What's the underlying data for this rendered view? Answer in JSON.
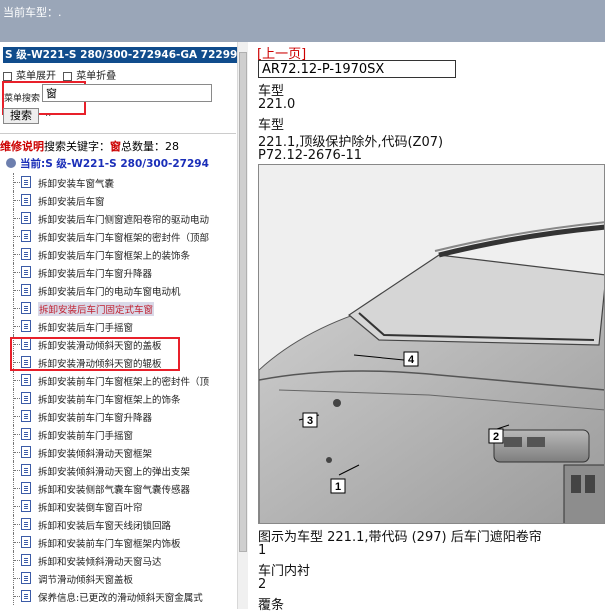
{
  "top": {
    "label": "当前车型：."
  },
  "left": {
    "header": "S 级-W221-S 280/300-272946-GA 72299",
    "menu_expand": "菜单展开",
    "menu_collapse": "菜单折叠",
    "search_label": "菜单搜索",
    "search_value": "窗",
    "search_button": "搜索",
    "search_extra": "..",
    "info_title": "维修说明",
    "info_keyword": "搜索关键字：",
    "info_keyword_value": "窗",
    "info_count_label": "总数量：",
    "info_count_value": "28",
    "root": "当前:S 级-W221-S 280/300-27294",
    "items": [
      "拆卸安装车窗气囊",
      "拆卸安装后车窗",
      "拆卸安装后车门侧窗遮阳卷帘的驱动电动",
      "拆卸安装后车门车窗框架的密封件（顶部",
      "拆卸安装后车门车窗框架上的装饰条",
      "拆卸安装后车门车窗升降器",
      "拆卸安装后车门的电动车窗电动机",
      "拆卸安装后车门固定式车窗",
      "拆卸安装后车门手摇窗",
      "拆卸安装滑动倾斜天窗的盖板",
      "拆卸安装滑动倾斜天窗的辊板",
      "拆卸安装前车门车窗框架上的密封件（顶",
      "拆卸安装前车门车窗框架上的饰条",
      "拆卸安装前车门车窗升降器",
      "拆卸安装前车门手摇窗",
      "拆卸安装倾斜滑动天窗框架",
      "拆卸安装倾斜滑动天窗上的弹出支架",
      "拆卸和安装侧部气囊车窗气囊传感器",
      "拆卸和安装倒车窗百叶帘",
      "拆卸和安装后车窗天线闭锁回路",
      "拆卸和安装前车门车窗框架内饰板",
      "拆卸和安装倾斜滑动天窗马达",
      "调节滑动倾斜天窗盖板",
      "保养信息:已更改的滑动倾斜天窗金属式"
    ],
    "selected_index": 7
  },
  "right": {
    "prev_link": "[上一页]",
    "doc_code": "AR72.12-P-1970SX",
    "lines": [
      "车型",
      "221.0",
      "车型",
      "221.1,顶级保护除外,代码(Z07)",
      "P72.12-2676-11"
    ],
    "callouts": [
      "1",
      "2",
      "3",
      "4"
    ],
    "caption": "图示为车型 221.1,带代码 (297) 后车门遮阳卷帘",
    "legend": [
      "1",
      "车门内衬",
      "2",
      "覆条"
    ]
  }
}
